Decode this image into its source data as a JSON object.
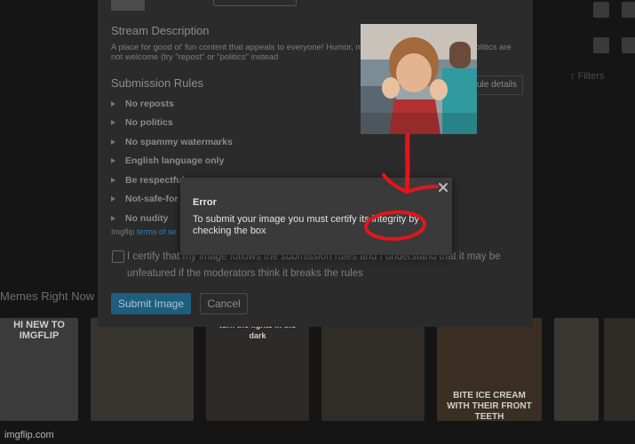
{
  "upload_panel": {
    "stream_description_heading": "Stream Description",
    "stream_description_text": "A place for good ol' fun content that appeals to everyone! Humor, me... come here. Reposts and politics are not welcome (try \"repost\" or \"politics\" instead",
    "submission_rules_heading": "Submission Rules",
    "rule_details_label": "ule details",
    "rules": [
      "No reposts",
      "No politics",
      "No spammy watermarks",
      "English language only",
      "Be respectful",
      "Not-safe-for",
      "No nudity"
    ],
    "terms_prefix": "Imgflip",
    "terms_link": "terms of se",
    "certify_text": "I certify that my image follows the submission rules and I understand that it may be unfeatured if the moderators think it breaks the rules",
    "submit_label": "Submit Image",
    "cancel_label": "Cancel"
  },
  "error_dialog": {
    "title": "Error",
    "message": "To submit your image you must certify its integrity by checking the box"
  },
  "background": {
    "section_label": "Memes Right Now",
    "side_filter": "↕ Filters",
    "thumb_captions": [
      "HI NEW TO IMGFLIP",
      "",
      "",
      "",
      "turn the lights in the dark",
      "",
      "BITE ICE CREAM WITH THEIR FRONT TEETH",
      ""
    ]
  },
  "watermark": "imgflip.com",
  "colors": {
    "annotation_red": "#e3151c",
    "accent_blue": "#1d5d7d"
  }
}
